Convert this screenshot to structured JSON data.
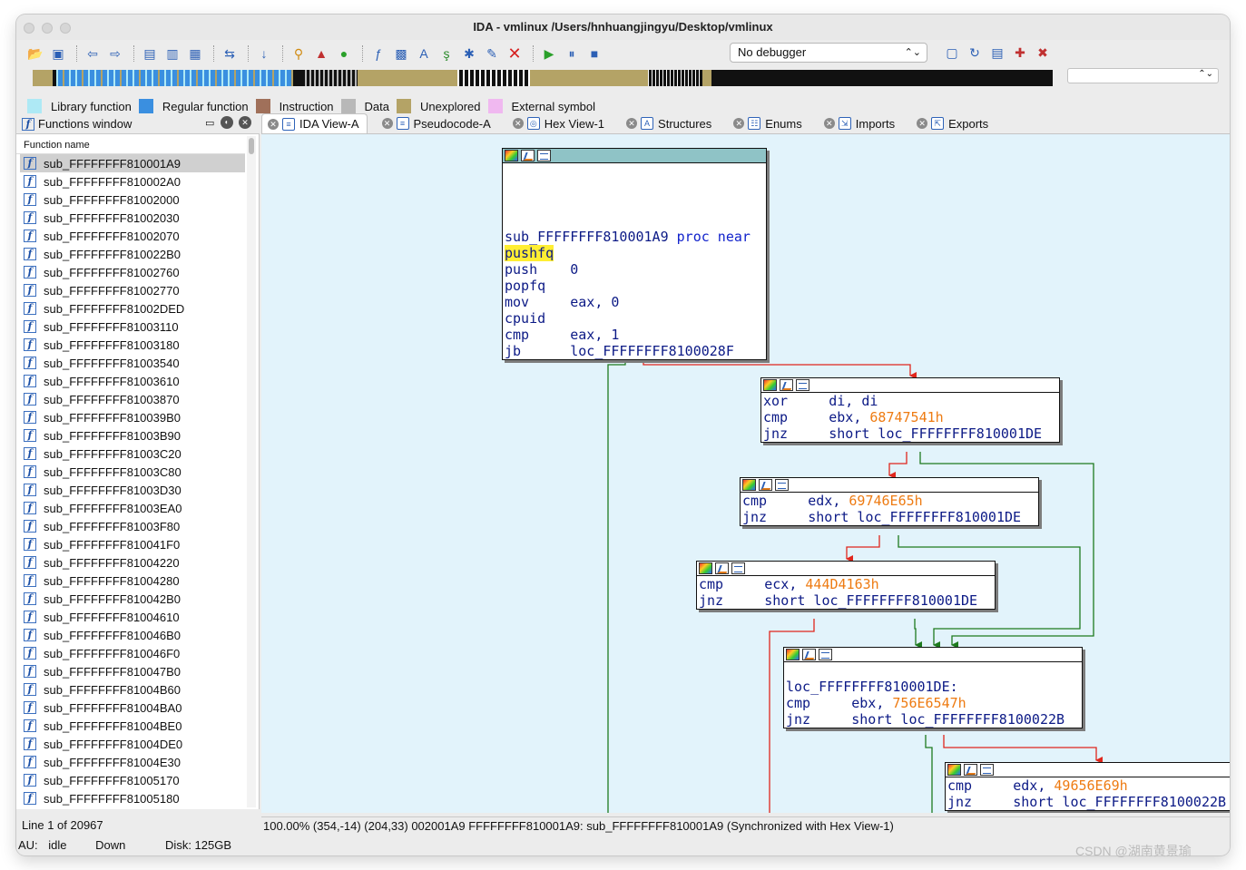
{
  "window": {
    "title": "IDA - vmlinux /Users/hnhuangjingyu/Desktop/vmlinux"
  },
  "toolbar": {
    "debugger_select": "No debugger",
    "icons": [
      "open-icon",
      "save-icon",
      "back-icon",
      "forward-icon",
      "binary-icon",
      "text-icon",
      "code-icon",
      "sync-icon",
      "jump-down-icon",
      "search-icon",
      "script-icon",
      "run-icon",
      "function-icon",
      "struct-icon",
      "xref-icon",
      "patch-icon",
      "edit-icon",
      "stop-icon",
      "play-icon",
      "pause-icon",
      "debug-stop-icon"
    ]
  },
  "legend": [
    {
      "label": "Library function",
      "color": "#aee9f5"
    },
    {
      "label": "Regular function",
      "color": "#3a8fe0"
    },
    {
      "label": "Instruction",
      "color": "#a0705a"
    },
    {
      "label": "Data",
      "color": "#b8b8b8"
    },
    {
      "label": "Unexplored",
      "color": "#b4a366"
    },
    {
      "label": "External symbol",
      "color": "#f0b8f0"
    }
  ],
  "functions_window": {
    "title": "Functions window",
    "column_header": "Function name",
    "items": [
      "sub_FFFFFFFF810001A9",
      "sub_FFFFFFFF810002A0",
      "sub_FFFFFFFF81002000",
      "sub_FFFFFFFF81002030",
      "sub_FFFFFFFF81002070",
      "sub_FFFFFFFF810022B0",
      "sub_FFFFFFFF81002760",
      "sub_FFFFFFFF81002770",
      "sub_FFFFFFFF81002DED",
      "sub_FFFFFFFF81003110",
      "sub_FFFFFFFF81003180",
      "sub_FFFFFFFF81003540",
      "sub_FFFFFFFF81003610",
      "sub_FFFFFFFF81003870",
      "sub_FFFFFFFF810039B0",
      "sub_FFFFFFFF81003B90",
      "sub_FFFFFFFF81003C20",
      "sub_FFFFFFFF81003C80",
      "sub_FFFFFFFF81003D30",
      "sub_FFFFFFFF81003EA0",
      "sub_FFFFFFFF81003F80",
      "sub_FFFFFFFF810041F0",
      "sub_FFFFFFFF81004220",
      "sub_FFFFFFFF81004280",
      "sub_FFFFFFFF810042B0",
      "sub_FFFFFFFF81004610",
      "sub_FFFFFFFF810046B0",
      "sub_FFFFFFFF810046F0",
      "sub_FFFFFFFF810047B0",
      "sub_FFFFFFFF81004B60",
      "sub_FFFFFFFF81004BA0",
      "sub_FFFFFFFF81004BE0",
      "sub_FFFFFFFF81004DE0",
      "sub_FFFFFFFF81004E30",
      "sub_FFFFFFFF81005170",
      "sub_FFFFFFFF81005180"
    ],
    "status": "Line 1 of 20967"
  },
  "tabs": [
    {
      "label": "IDA View-A",
      "active": true
    },
    {
      "label": "Pseudocode-A"
    },
    {
      "label": "Hex View-1"
    },
    {
      "label": "Structures"
    },
    {
      "label": "Enums"
    },
    {
      "label": "Imports"
    },
    {
      "label": "Exports"
    }
  ],
  "graph": {
    "nodes": [
      {
        "id": "n0",
        "lines": [
          {
            "t": ""
          },
          {
            "t": ""
          },
          {
            "t": ""
          },
          {
            "t": ""
          },
          {
            "t": "sub_FFFFFFFF810001A9 proc near"
          },
          {
            "t": "pushfq"
          },
          {
            "t": "push    0"
          },
          {
            "t": "popfq"
          },
          {
            "t": "mov     eax, 0"
          },
          {
            "t": "cpuid"
          },
          {
            "t": "cmp     eax, 1"
          },
          {
            "t": "jb      loc_FFFFFFFF8100028F"
          }
        ]
      },
      {
        "id": "n1",
        "lines": [
          {
            "t": "xor     di, di"
          },
          {
            "t": "cmp     ebx, 68747541h"
          },
          {
            "t": "jnz     short loc_FFFFFFFF810001DE"
          }
        ]
      },
      {
        "id": "n2",
        "lines": [
          {
            "t": "cmp     edx, 69746E65h"
          },
          {
            "t": "jnz     short loc_FFFFFFFF810001DE"
          }
        ]
      },
      {
        "id": "n3",
        "lines": [
          {
            "t": "cmp     ecx, 444D4163h"
          },
          {
            "t": "jnz     short loc_FFFFFFFF810001DE"
          }
        ]
      },
      {
        "id": "n4",
        "lines": [
          {
            "t": ""
          },
          {
            "t": "loc_FFFFFFFF810001DE:"
          },
          {
            "t": "cmp     ebx, 756E6547h"
          },
          {
            "t": "jnz     short loc_FFFFFFFF8100022B"
          }
        ]
      },
      {
        "id": "n5",
        "lines": [
          {
            "t": "cmp     edx, 49656E69h"
          },
          {
            "t": "jnz     short loc_FFFFFFFF8100022B"
          }
        ]
      }
    ]
  },
  "status": {
    "main": "100.00% (354,-14) (204,33) 002001A9 FFFFFFFF810001A9: sub_FFFFFFFF810001A9 (Synchronized with Hex View-1)",
    "au_label": "AU:",
    "au_state": "idle",
    "direction": "Down",
    "disk": "Disk: 125GB"
  },
  "watermark": "CSDN @湖南黄景瑜"
}
